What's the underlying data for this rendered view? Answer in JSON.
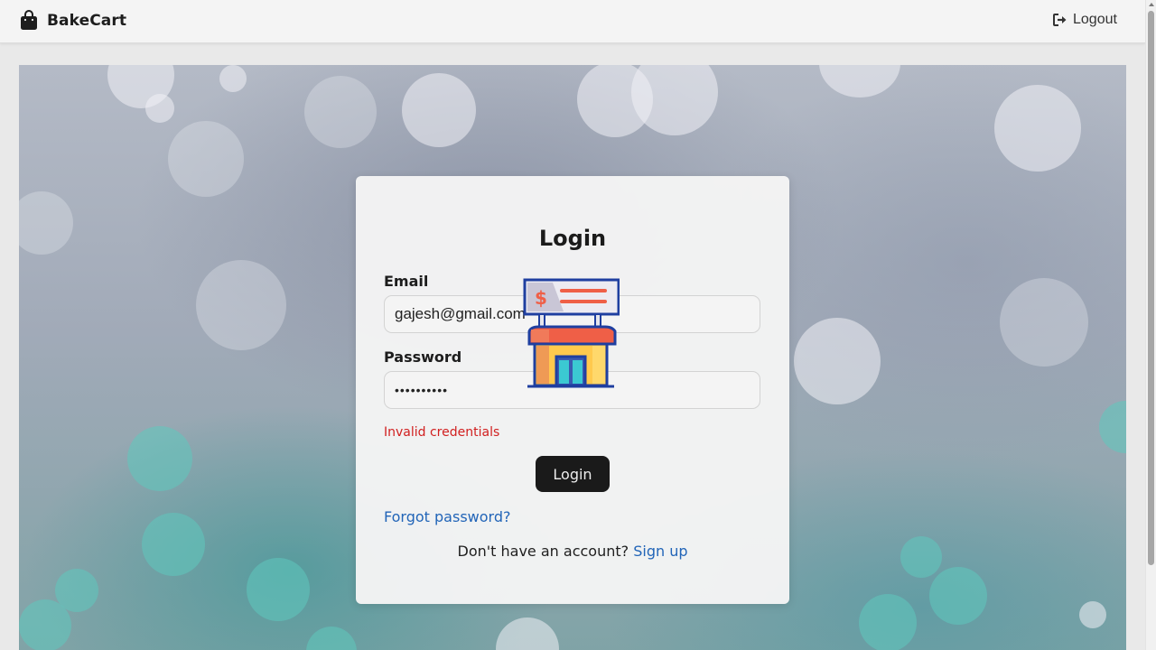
{
  "navbar": {
    "brand_name": "BakeCart",
    "brand_icon": "shopping-bag-icon",
    "logout_label": "Logout",
    "logout_icon": "sign-out-icon"
  },
  "login": {
    "title": "Login",
    "email_label": "Email",
    "email_value": "gajesh@gmail.com",
    "password_label": "Password",
    "password_value": "••••••••••",
    "error_text": "Invalid credentials",
    "submit_label": "Login",
    "forgot_label": "Forgot password?",
    "signup_prompt": "Don't have an account?",
    "signup_label": "Sign up"
  },
  "store_graphic": "storefront-with-dollar-sign-icon",
  "colors": {
    "error": "#d11f1f",
    "link": "#2265b8",
    "button_bg": "#1a1a1a"
  }
}
